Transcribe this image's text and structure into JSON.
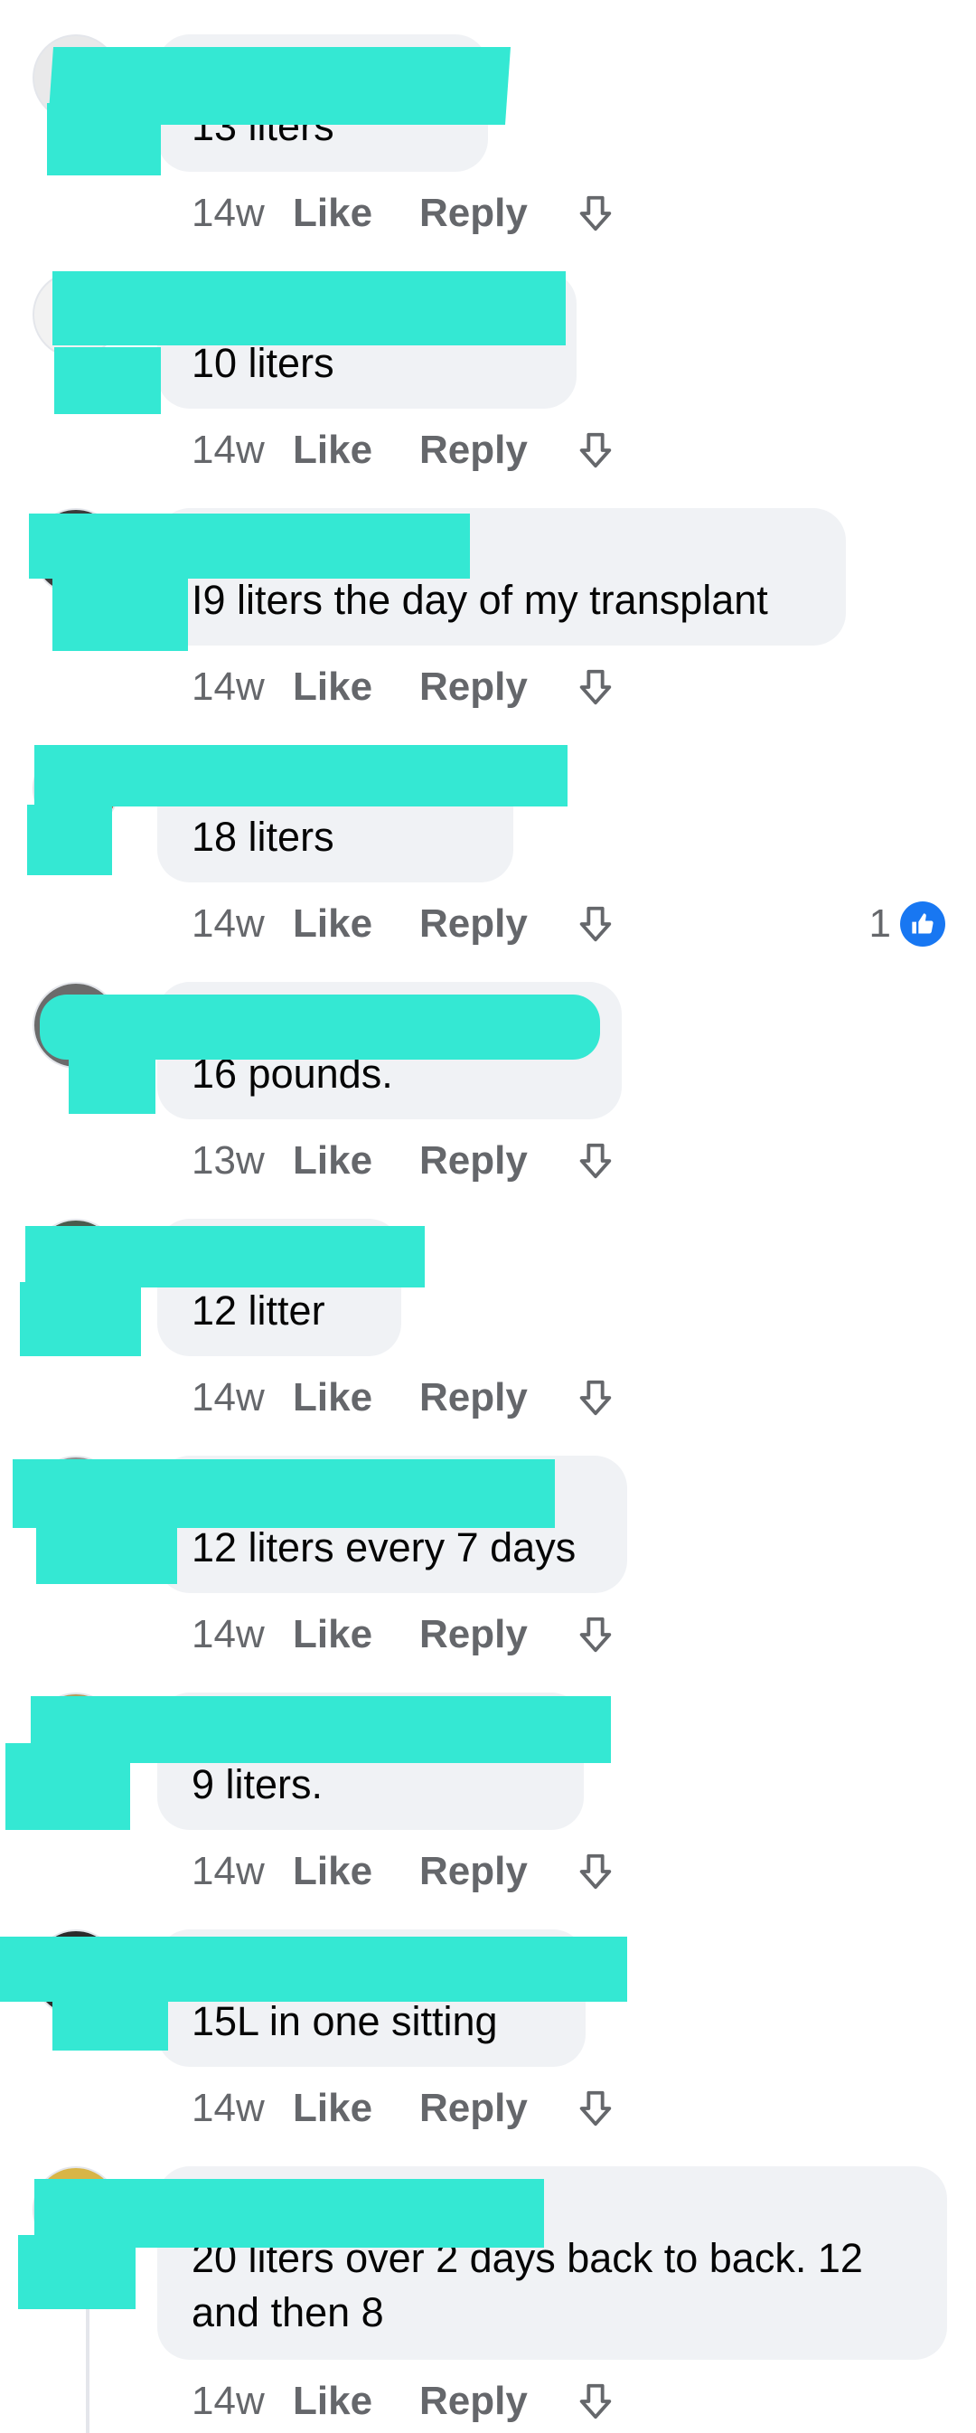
{
  "comments": [
    {
      "text": "13 liters",
      "age": "14w",
      "like": "Like",
      "reply": "Reply"
    },
    {
      "text": "10 liters",
      "age": "14w",
      "like": "Like",
      "reply": "Reply"
    },
    {
      "text": "I9 liters the day of my transplant",
      "age": "14w",
      "like": "Like",
      "reply": "Reply"
    },
    {
      "text": "18 liters",
      "age": "14w",
      "like": "Like",
      "reply": "Reply",
      "reaction_count": "1"
    },
    {
      "text": "16 pounds.",
      "age": "13w",
      "like": "Like",
      "reply": "Reply"
    },
    {
      "text": "12 litter",
      "age": "14w",
      "like": "Like",
      "reply": "Reply"
    },
    {
      "text": "12 liters every 7 days",
      "age": "14w",
      "like": "Like",
      "reply": "Reply"
    },
    {
      "text": "9 liters.",
      "age": "14w",
      "like": "Like",
      "reply": "Reply"
    },
    {
      "text": "15L in one sitting",
      "age": "14w",
      "like": "Like",
      "reply": "Reply"
    },
    {
      "text": "20 liters over 2 days back to back. 12 and then 8",
      "age": "14w",
      "like": "Like",
      "reply": "Reply"
    }
  ],
  "icons": {
    "downvote": "arrow-down-outline-icon",
    "like_reaction": "thumbs-up-icon"
  },
  "colors": {
    "bubble": "#f0f2f5",
    "meta_text": "#65676b",
    "like_reaction": "#1877f2",
    "redaction": "#34e8d3"
  }
}
